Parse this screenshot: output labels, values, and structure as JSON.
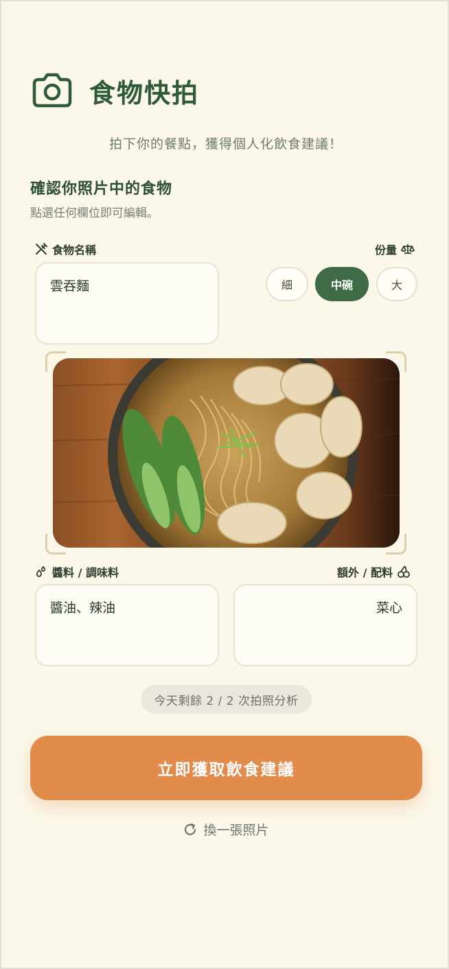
{
  "header": {
    "title": "食物快拍",
    "icon": "camera-icon"
  },
  "subtitle": "拍下你的餐點，獲得個人化飲食建議！",
  "section": {
    "title": "確認你照片中的食物",
    "hint": "點選任何欄位即可編輯。"
  },
  "food_name": {
    "label": "食物名稱",
    "value": "雲吞麵",
    "icon": "utensils-icon"
  },
  "portion": {
    "label": "份量",
    "icon": "scale-icon",
    "options": [
      "細",
      "中碗",
      "大"
    ],
    "selected": "中碗"
  },
  "photo": {
    "alt_icon": "food-photo"
  },
  "sauces": {
    "label": "醬料 / 調味料",
    "value": "醬油、辣油",
    "icon": "droplets-icon"
  },
  "extras": {
    "label": "額外 / 配料",
    "value": "菜心",
    "icon": "cherries-icon"
  },
  "quota": "今天剩餘 2 / 2 次拍照分析",
  "cta": "立即獲取飲食建議",
  "retake": {
    "label": "換一張照片",
    "icon": "refresh-icon"
  },
  "colors": {
    "accent": "#e28c4c",
    "primary": "#3f6b47",
    "background": "#fbf8ea"
  }
}
